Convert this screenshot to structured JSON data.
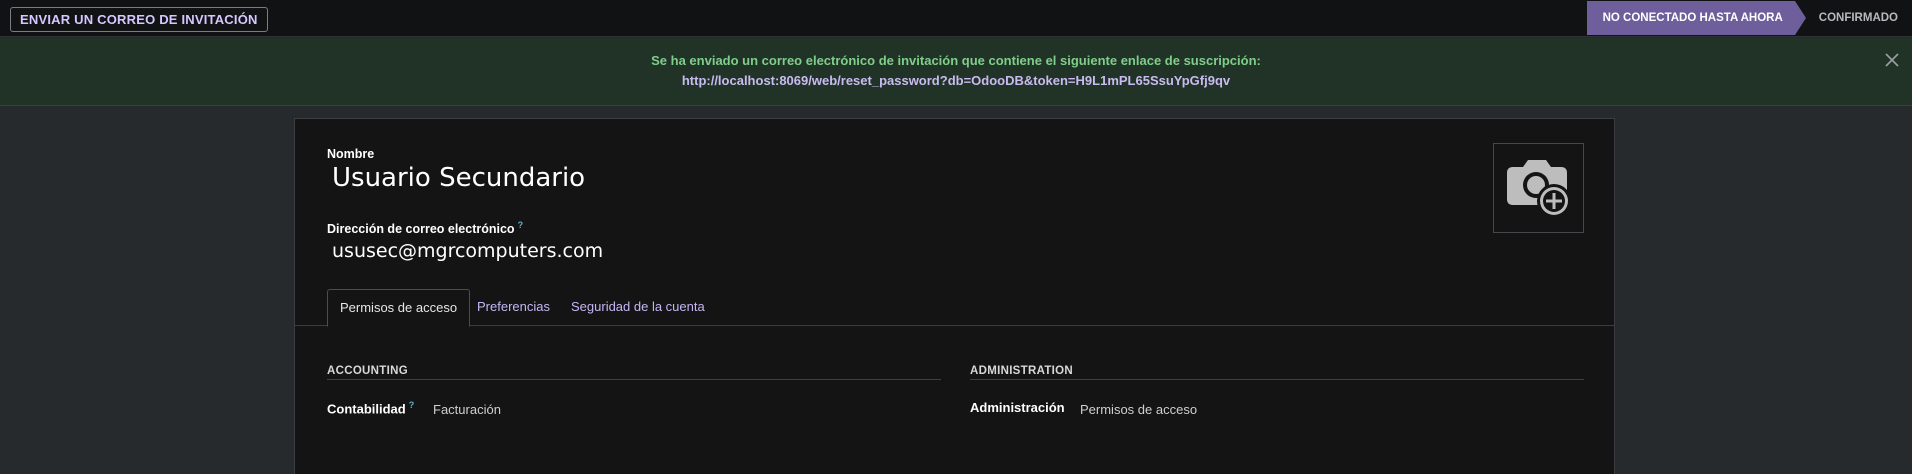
{
  "topbar": {
    "invite_button": "ENVIAR UN CORREO DE INVITACIÓN",
    "stages": {
      "current": "NO CONECTADO HASTA AHORA",
      "next": "CONFIRMADO"
    },
    "accent_color": "#6e5e9c"
  },
  "alert": {
    "message": "Se ha enviado un correo electrónico de invitación que contiene el siguiente enlace de suscripción:",
    "link": "http://localhost:8069/web/reset_password?db=OdooDB&token=H9L1mPL65SsuYpGfj9qv",
    "close_icon": "close-icon"
  },
  "form": {
    "name_label": "Nombre",
    "name_value": "Usuario Secundario",
    "email_label": "Dirección de correo electrónico",
    "email_help": "?",
    "email_value": "ususec@mgrcomputers.com",
    "avatar_icon": "camera-plus-icon"
  },
  "tabs": [
    {
      "label": "Permisos de acceso",
      "active": true
    },
    {
      "label": "Preferencias",
      "active": false
    },
    {
      "label": "Seguridad de la cuenta",
      "active": false
    }
  ],
  "groups": [
    {
      "title": "ACCOUNTING",
      "field_label": "Contabilidad",
      "field_help": "?",
      "field_value": "Facturación"
    },
    {
      "title": "ADMINISTRATION",
      "field_label": "Administración",
      "field_value": "Permisos de acceso"
    }
  ]
}
